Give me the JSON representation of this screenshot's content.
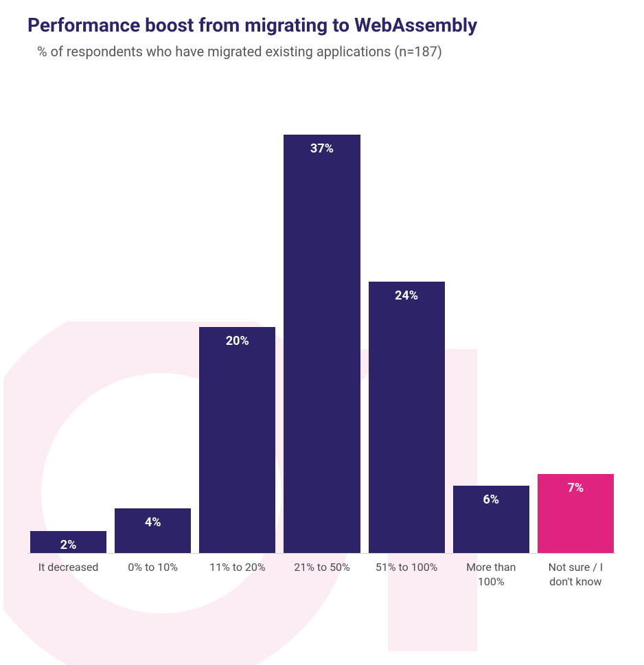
{
  "title": "Performance boost from migrating to WebAssembly",
  "subtitle": "% of respondents who have migrated existing applications (n=187)",
  "colors": {
    "primary": "#2d2368",
    "accent": "#e0237e"
  },
  "chart_data": {
    "type": "bar",
    "title": "Performance boost from migrating to WebAssembly",
    "subtitle": "% of respondents who have migrated existing applications (n=187)",
    "xlabel": "",
    "ylabel": "",
    "ylim": [
      0,
      40
    ],
    "categories": [
      "It decreased",
      "0% to 10%",
      "11% to 20%",
      "21% to 50%",
      "51% to 100%",
      "More than 100%",
      "Not sure / I don't know"
    ],
    "values": [
      2,
      4,
      20,
      37,
      24,
      6,
      7
    ],
    "value_labels": [
      "2%",
      "4%",
      "20%",
      "37%",
      "24%",
      "6%",
      "7%"
    ],
    "bar_colors": [
      "primary",
      "primary",
      "primary",
      "primary",
      "primary",
      "primary",
      "accent"
    ]
  }
}
